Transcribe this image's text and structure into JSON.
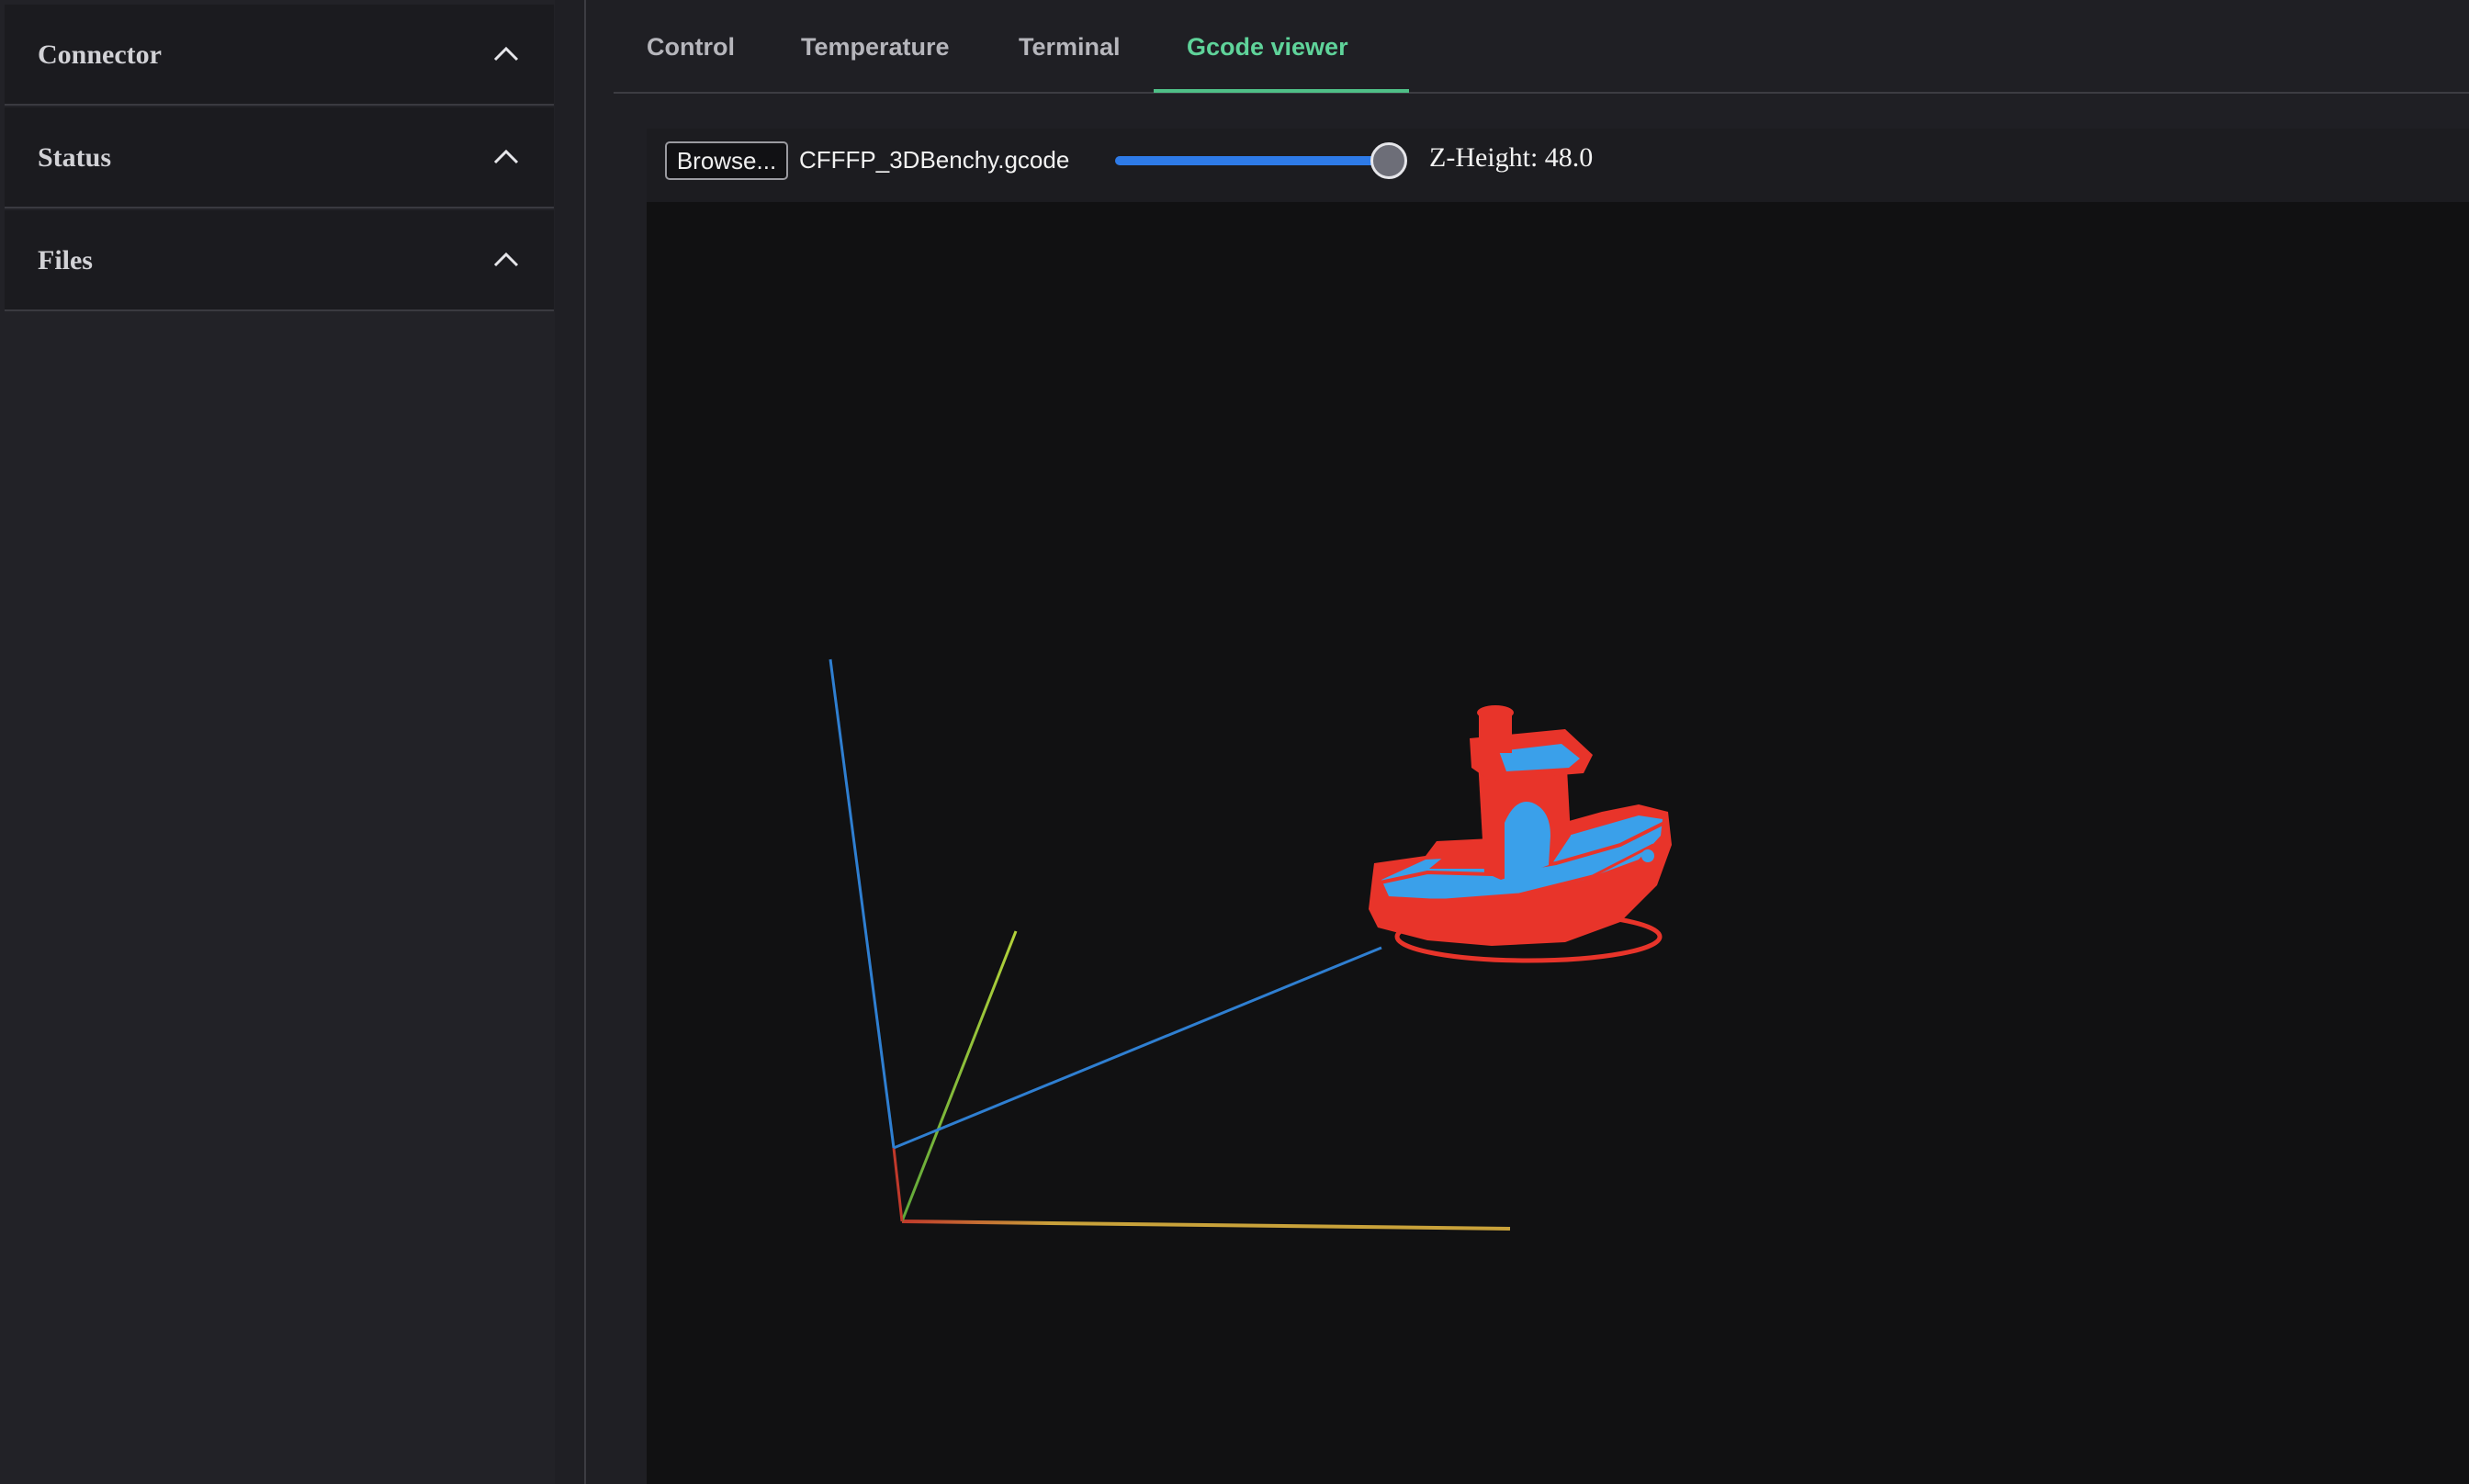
{
  "sidebar": {
    "sections": [
      {
        "label": "Connector"
      },
      {
        "label": "Status"
      },
      {
        "label": "Files"
      }
    ]
  },
  "tabs": [
    {
      "label": "Control"
    },
    {
      "label": "Temperature"
    },
    {
      "label": "Terminal"
    },
    {
      "label": "Gcode viewer",
      "active": true
    }
  ],
  "toolbar": {
    "browse_label": "Browse...",
    "filename": "CFFFP_3DBenchy.gcode",
    "z_height_label": "Z-Height: 48.0",
    "z_height_value": 48.0,
    "z_slider_fraction": 1.0
  },
  "colors": {
    "accent": "#5fd39a",
    "slider": "#2e7be8",
    "model_outer": "#e8342a",
    "model_infill": "#3aa0ea",
    "axis_x": "#c9a23a",
    "axis_y": "#8ccf3a",
    "axis_z": "#2f7fd1"
  }
}
